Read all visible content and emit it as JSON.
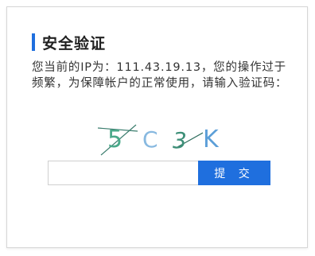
{
  "dialog": {
    "title": "安全验证",
    "message": "您当前的IP为：111.43.19.13，您的操作过于频繁，为保障帐户的正常使用，请输入验证码：",
    "captcha": {
      "chars": [
        "5",
        "C",
        "3",
        "K"
      ],
      "colors": [
        "#4aa98a",
        "#88b9e0",
        "#3d8f78",
        "#5c9fd8"
      ]
    },
    "input": {
      "value": "",
      "placeholder": ""
    },
    "submit_label": "提 交",
    "accent_color": "#1f6fde"
  }
}
